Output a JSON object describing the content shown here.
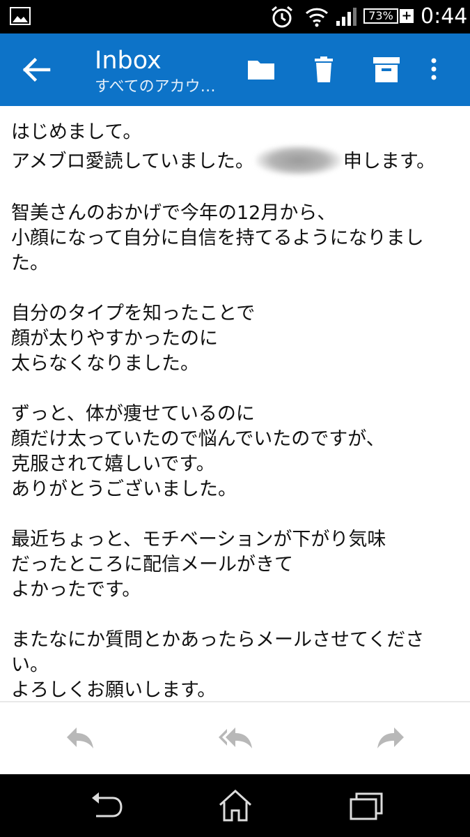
{
  "status_bar": {
    "battery_percent": "73%",
    "time": "0:44",
    "icons": [
      "gallery-icon",
      "alarm-icon",
      "wifi-icon",
      "signal-icon",
      "battery-icon"
    ]
  },
  "app_bar": {
    "title": "Inbox",
    "subtitle": "すべてのアカウ…",
    "icons": [
      "back-arrow-icon",
      "folder-icon",
      "trash-icon",
      "archive-icon",
      "more-vert-icon"
    ]
  },
  "message": {
    "paragraphs": [
      [
        "はじめまして。",
        "アメブロ愛読していました。",
        "申します。"
      ],
      [
        "智美さんのおかげで今年の12月から、",
        "小顔になって自分に自信を持てるようになりまし",
        "た。"
      ],
      [
        "自分のタイプを知ったことで",
        "顔が太りやすかったのに",
        "太らなくなりました。"
      ],
      [
        "ずっと、体が痩せているのに",
        "顔だけ太っていたので悩んでいたのですが、",
        "克服されて嬉しいです。",
        "ありがとうございました。"
      ],
      [
        "最近ちょっと、モチベーションが下がり気味",
        "だったところに配信メールがきて",
        "よかったです。"
      ],
      [
        "またなにか質問とかあったらメールさせてくださ",
        "い。",
        "よろしくお願いします。"
      ]
    ]
  },
  "reply_actions": {
    "icons": [
      "reply-icon",
      "reply-all-icon",
      "forward-icon"
    ]
  },
  "nav_bar": {
    "icons": [
      "nav-back-icon",
      "home-icon",
      "recents-icon"
    ]
  }
}
